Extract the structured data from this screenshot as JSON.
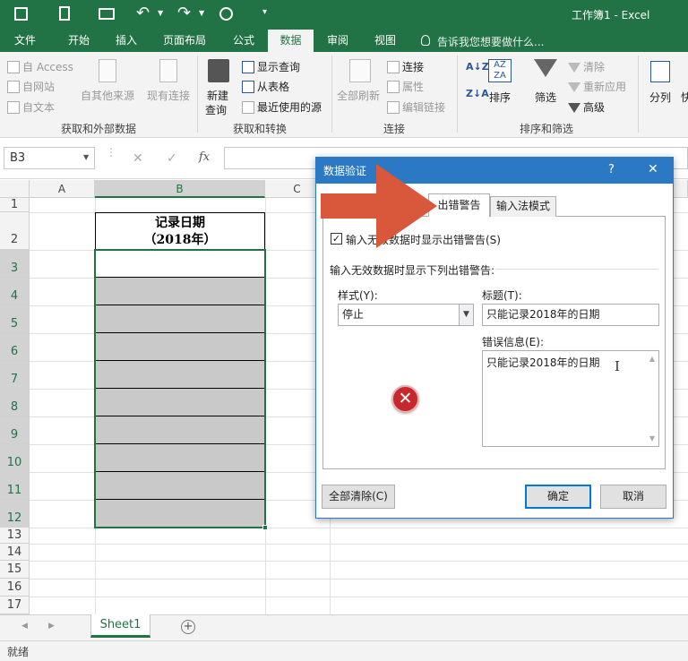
{
  "title_bar": {
    "workbook_title": "工作簿1 - Excel"
  },
  "tabs": [
    "文件",
    "开始",
    "插入",
    "页面布局",
    "公式",
    "数据",
    "审阅",
    "视图"
  ],
  "tell_me": "告诉我您想要做什么...",
  "ribbon": {
    "get_external": {
      "access": "自 Access",
      "web": "自网站",
      "text": "自文本",
      "other": "自其他来源",
      "existing": "现有连接",
      "label": "获取和外部数据"
    },
    "transform": {
      "new_query": "新建",
      "new_query2": "查询",
      "show_query": "显示查询",
      "from_table": "从表格",
      "recent_sources": "最近使用的源",
      "label": "获取和转换"
    },
    "connections": {
      "refresh_all": "全部刷新",
      "connections": "连接",
      "properties": "属性",
      "edit_links": "编辑链接",
      "label": "连接"
    },
    "sort_filter": {
      "sort": "排序",
      "filter": "筛选",
      "clear": "清除",
      "reapply": "重新应用",
      "advanced": "高级",
      "label": "排序和筛选"
    },
    "data_tools": {
      "split": "分列",
      "quick": "快"
    }
  },
  "formula_bar": {
    "name_box": "B3",
    "fx": "fx",
    "cancel": "✕",
    "enter": "✓"
  },
  "grid": {
    "columns": [
      "A",
      "B",
      "C"
    ],
    "rows": [
      "1",
      "2",
      "3",
      "4",
      "5",
      "6",
      "7",
      "8",
      "9",
      "10",
      "11",
      "12",
      "13",
      "14",
      "15",
      "16",
      "17"
    ],
    "header_cell_line1": "记录日期",
    "header_cell_line2": "（2018年）"
  },
  "dialog": {
    "title": "数据验证",
    "help": "?",
    "close": "✕",
    "tab_error": "出错警告",
    "tab_ime": "输入法模式",
    "checkbox_label": "输入无效数据时显示出错警告(S)",
    "checkbox_checked": true,
    "section_label": "输入无效数据时显示下列出错警告:",
    "style_label": "样式(Y):",
    "style_value": "停止",
    "title_label": "标题(T):",
    "title_value": "只能记录2018年的日期",
    "message_label": "错误信息(E):",
    "message_value": "只能记录2018年的日期",
    "clear_all": "全部清除(C)",
    "ok": "确定",
    "cancel": "取消"
  },
  "sheet_tabs": {
    "sheet1": "Sheet1",
    "add": "+"
  },
  "status": {
    "ready": "就绪"
  },
  "colors": {
    "excel_green": "#217346",
    "dialog_blue": "#2b78c4",
    "arrow": "#d9573a",
    "gray_fill": "#c9c9c9"
  }
}
